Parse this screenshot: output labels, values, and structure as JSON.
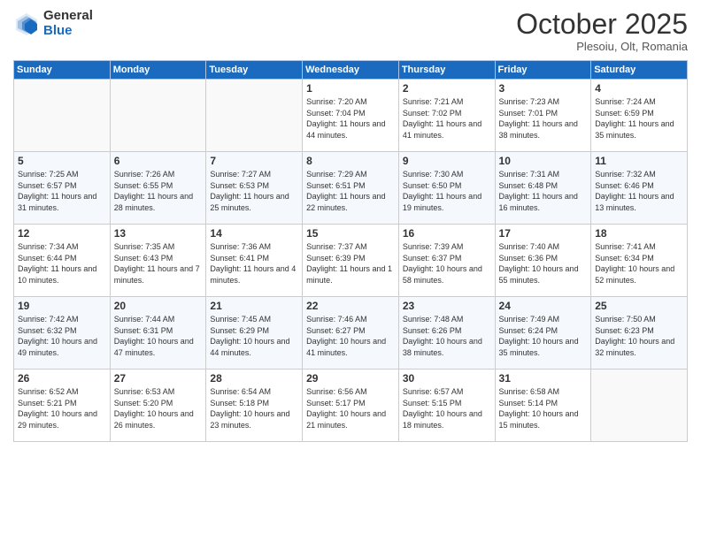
{
  "logo": {
    "general": "General",
    "blue": "Blue"
  },
  "header": {
    "month": "October 2025",
    "location": "Plesoiu, Olt, Romania"
  },
  "weekdays": [
    "Sunday",
    "Monday",
    "Tuesday",
    "Wednesday",
    "Thursday",
    "Friday",
    "Saturday"
  ],
  "weeks": [
    [
      {
        "day": "",
        "sunrise": "",
        "sunset": "",
        "daylight": ""
      },
      {
        "day": "",
        "sunrise": "",
        "sunset": "",
        "daylight": ""
      },
      {
        "day": "",
        "sunrise": "",
        "sunset": "",
        "daylight": ""
      },
      {
        "day": "1",
        "sunrise": "Sunrise: 7:20 AM",
        "sunset": "Sunset: 7:04 PM",
        "daylight": "Daylight: 11 hours and 44 minutes."
      },
      {
        "day": "2",
        "sunrise": "Sunrise: 7:21 AM",
        "sunset": "Sunset: 7:02 PM",
        "daylight": "Daylight: 11 hours and 41 minutes."
      },
      {
        "day": "3",
        "sunrise": "Sunrise: 7:23 AM",
        "sunset": "Sunset: 7:01 PM",
        "daylight": "Daylight: 11 hours and 38 minutes."
      },
      {
        "day": "4",
        "sunrise": "Sunrise: 7:24 AM",
        "sunset": "Sunset: 6:59 PM",
        "daylight": "Daylight: 11 hours and 35 minutes."
      }
    ],
    [
      {
        "day": "5",
        "sunrise": "Sunrise: 7:25 AM",
        "sunset": "Sunset: 6:57 PM",
        "daylight": "Daylight: 11 hours and 31 minutes."
      },
      {
        "day": "6",
        "sunrise": "Sunrise: 7:26 AM",
        "sunset": "Sunset: 6:55 PM",
        "daylight": "Daylight: 11 hours and 28 minutes."
      },
      {
        "day": "7",
        "sunrise": "Sunrise: 7:27 AM",
        "sunset": "Sunset: 6:53 PM",
        "daylight": "Daylight: 11 hours and 25 minutes."
      },
      {
        "day": "8",
        "sunrise": "Sunrise: 7:29 AM",
        "sunset": "Sunset: 6:51 PM",
        "daylight": "Daylight: 11 hours and 22 minutes."
      },
      {
        "day": "9",
        "sunrise": "Sunrise: 7:30 AM",
        "sunset": "Sunset: 6:50 PM",
        "daylight": "Daylight: 11 hours and 19 minutes."
      },
      {
        "day": "10",
        "sunrise": "Sunrise: 7:31 AM",
        "sunset": "Sunset: 6:48 PM",
        "daylight": "Daylight: 11 hours and 16 minutes."
      },
      {
        "day": "11",
        "sunrise": "Sunrise: 7:32 AM",
        "sunset": "Sunset: 6:46 PM",
        "daylight": "Daylight: 11 hours and 13 minutes."
      }
    ],
    [
      {
        "day": "12",
        "sunrise": "Sunrise: 7:34 AM",
        "sunset": "Sunset: 6:44 PM",
        "daylight": "Daylight: 11 hours and 10 minutes."
      },
      {
        "day": "13",
        "sunrise": "Sunrise: 7:35 AM",
        "sunset": "Sunset: 6:43 PM",
        "daylight": "Daylight: 11 hours and 7 minutes."
      },
      {
        "day": "14",
        "sunrise": "Sunrise: 7:36 AM",
        "sunset": "Sunset: 6:41 PM",
        "daylight": "Daylight: 11 hours and 4 minutes."
      },
      {
        "day": "15",
        "sunrise": "Sunrise: 7:37 AM",
        "sunset": "Sunset: 6:39 PM",
        "daylight": "Daylight: 11 hours and 1 minute."
      },
      {
        "day": "16",
        "sunrise": "Sunrise: 7:39 AM",
        "sunset": "Sunset: 6:37 PM",
        "daylight": "Daylight: 10 hours and 58 minutes."
      },
      {
        "day": "17",
        "sunrise": "Sunrise: 7:40 AM",
        "sunset": "Sunset: 6:36 PM",
        "daylight": "Daylight: 10 hours and 55 minutes."
      },
      {
        "day": "18",
        "sunrise": "Sunrise: 7:41 AM",
        "sunset": "Sunset: 6:34 PM",
        "daylight": "Daylight: 10 hours and 52 minutes."
      }
    ],
    [
      {
        "day": "19",
        "sunrise": "Sunrise: 7:42 AM",
        "sunset": "Sunset: 6:32 PM",
        "daylight": "Daylight: 10 hours and 49 minutes."
      },
      {
        "day": "20",
        "sunrise": "Sunrise: 7:44 AM",
        "sunset": "Sunset: 6:31 PM",
        "daylight": "Daylight: 10 hours and 47 minutes."
      },
      {
        "day": "21",
        "sunrise": "Sunrise: 7:45 AM",
        "sunset": "Sunset: 6:29 PM",
        "daylight": "Daylight: 10 hours and 44 minutes."
      },
      {
        "day": "22",
        "sunrise": "Sunrise: 7:46 AM",
        "sunset": "Sunset: 6:27 PM",
        "daylight": "Daylight: 10 hours and 41 minutes."
      },
      {
        "day": "23",
        "sunrise": "Sunrise: 7:48 AM",
        "sunset": "Sunset: 6:26 PM",
        "daylight": "Daylight: 10 hours and 38 minutes."
      },
      {
        "day": "24",
        "sunrise": "Sunrise: 7:49 AM",
        "sunset": "Sunset: 6:24 PM",
        "daylight": "Daylight: 10 hours and 35 minutes."
      },
      {
        "day": "25",
        "sunrise": "Sunrise: 7:50 AM",
        "sunset": "Sunset: 6:23 PM",
        "daylight": "Daylight: 10 hours and 32 minutes."
      }
    ],
    [
      {
        "day": "26",
        "sunrise": "Sunrise: 6:52 AM",
        "sunset": "Sunset: 5:21 PM",
        "daylight": "Daylight: 10 hours and 29 minutes."
      },
      {
        "day": "27",
        "sunrise": "Sunrise: 6:53 AM",
        "sunset": "Sunset: 5:20 PM",
        "daylight": "Daylight: 10 hours and 26 minutes."
      },
      {
        "day": "28",
        "sunrise": "Sunrise: 6:54 AM",
        "sunset": "Sunset: 5:18 PM",
        "daylight": "Daylight: 10 hours and 23 minutes."
      },
      {
        "day": "29",
        "sunrise": "Sunrise: 6:56 AM",
        "sunset": "Sunset: 5:17 PM",
        "daylight": "Daylight: 10 hours and 21 minutes."
      },
      {
        "day": "30",
        "sunrise": "Sunrise: 6:57 AM",
        "sunset": "Sunset: 5:15 PM",
        "daylight": "Daylight: 10 hours and 18 minutes."
      },
      {
        "day": "31",
        "sunrise": "Sunrise: 6:58 AM",
        "sunset": "Sunset: 5:14 PM",
        "daylight": "Daylight: 10 hours and 15 minutes."
      },
      {
        "day": "",
        "sunrise": "",
        "sunset": "",
        "daylight": ""
      }
    ]
  ]
}
